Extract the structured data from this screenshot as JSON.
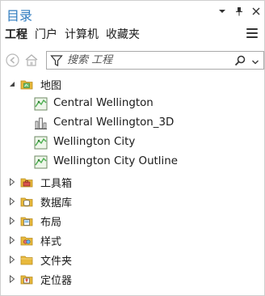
{
  "pane": {
    "title": "目录",
    "controls": {
      "dropdown": "▾",
      "pin": "⊥",
      "close": "×"
    }
  },
  "tabs": [
    {
      "label": "工程",
      "active": true
    },
    {
      "label": "门户",
      "active": false
    },
    {
      "label": "计算机",
      "active": false
    },
    {
      "label": "收藏夹",
      "active": false
    }
  ],
  "search": {
    "placeholder": "搜索 工程",
    "value": ""
  },
  "tree": {
    "maps": {
      "label": "地图",
      "expanded": true,
      "items": [
        {
          "label": "Central Wellington",
          "type": "map"
        },
        {
          "label": "Central Wellington_3D",
          "type": "scene"
        },
        {
          "label": "Wellington City",
          "type": "map"
        },
        {
          "label": "Wellington City Outline",
          "type": "map"
        }
      ]
    },
    "folders": [
      {
        "label": "工具箱",
        "icon": "toolbox-folder-icon"
      },
      {
        "label": "数据库",
        "icon": "database-folder-icon"
      },
      {
        "label": "布局",
        "icon": "layout-folder-icon"
      },
      {
        "label": "样式",
        "icon": "style-folder-icon"
      },
      {
        "label": "文件夹",
        "icon": "folder-icon"
      },
      {
        "label": "定位器",
        "icon": "locator-folder-icon"
      }
    ]
  },
  "colors": {
    "title": "#2f7bbf",
    "folder": "#e8b93c",
    "map_green": "#4caf50"
  }
}
